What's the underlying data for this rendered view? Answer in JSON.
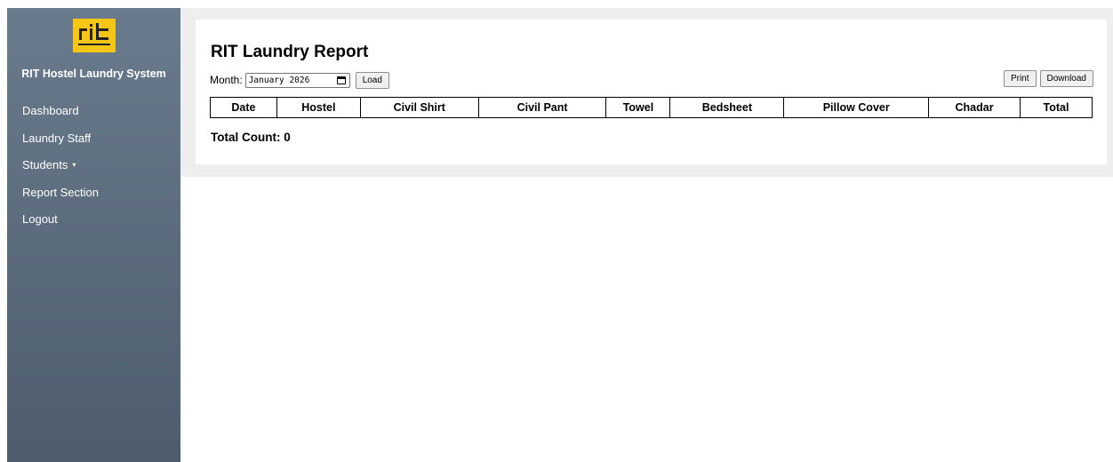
{
  "sidebar": {
    "logo_icon": "rit-logo-icon",
    "brand_color": "#f5c518",
    "brand_name": "RIT Hostel Laundry System",
    "items": [
      {
        "label": "Dashboard"
      },
      {
        "label": "Laundry Staff"
      },
      {
        "label": "Students",
        "caret": "▾"
      },
      {
        "label": "Report Section"
      },
      {
        "label": "Logout"
      }
    ]
  },
  "report": {
    "title": "RIT Laundry Report",
    "month_label": "Month:",
    "month_value": "January 2026",
    "load_label": "Load",
    "print_label": "Print",
    "download_label": "Download",
    "columns": [
      "Date",
      "Hostel",
      "Civil Shirt",
      "Civil Pant",
      "Towel",
      "Bedsheet",
      "Pillow Cover",
      "Chadar",
      "Total"
    ],
    "total_count": "Total Count: 0"
  }
}
